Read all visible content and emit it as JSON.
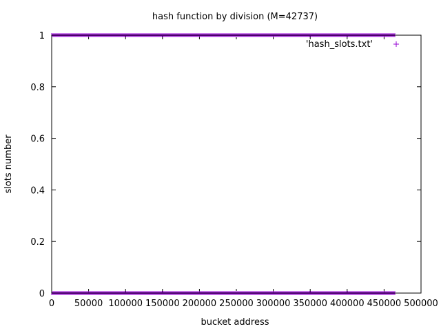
{
  "chart_data": {
    "type": "scatter",
    "title": "hash function by division (M=42737)",
    "xlabel": "bucket address",
    "ylabel": "slots number",
    "xlim": [
      0,
      500000
    ],
    "ylim": [
      0,
      1
    ],
    "x_ticks": [
      "0",
      "50000",
      "100000",
      "150000",
      "200000",
      "250000",
      "300000",
      "350000",
      "400000",
      "450000",
      "500000"
    ],
    "x_tick_values": [
      0,
      50000,
      100000,
      150000,
      200000,
      250000,
      300000,
      350000,
      400000,
      450000,
      500000
    ],
    "y_ticks": [
      "0",
      "0.2",
      "0.4",
      "0.6",
      "0.8",
      "1"
    ],
    "y_tick_values": [
      0,
      0.2,
      0.4,
      0.6,
      0.8,
      1
    ],
    "grid": false,
    "legend_position": "top-right",
    "series": [
      {
        "name": "'hash_slots.txt'",
        "marker": "+",
        "color": "#9400d3",
        "bands": [
          {
            "y": 1,
            "x_start": 0,
            "x_end": 465000
          },
          {
            "y": 0,
            "x_start": 0,
            "x_end": 465000
          }
        ]
      }
    ]
  }
}
